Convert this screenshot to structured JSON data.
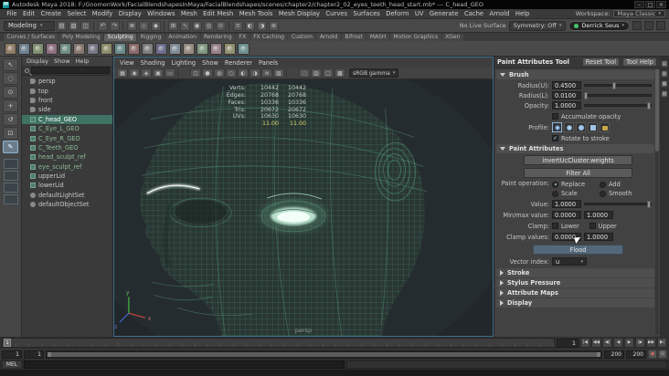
{
  "window": {
    "title": "Autodesk Maya 2018: F:/GnomonWork/FacialBlendshapesInMaya/FacialBlendshapes/scenes/chapter2/chapter2_02_eyes_teeth_head_start.mb* --- C_head_GEO",
    "buttons": [
      {
        "name": "minimize-button",
        "glyph": "–"
      },
      {
        "name": "maximize-button",
        "glyph": "□"
      },
      {
        "name": "close-button",
        "glyph": "×"
      }
    ],
    "logo_letter": "M"
  },
  "menubar": {
    "items": [
      {
        "label": "File"
      },
      {
        "label": "Edit"
      },
      {
        "label": "Create"
      },
      {
        "label": "Select"
      },
      {
        "label": "Modify"
      },
      {
        "label": "Display"
      },
      {
        "label": "Windows"
      },
      {
        "label": "Mesh"
      },
      {
        "label": "Edit Mesh"
      },
      {
        "label": "Mesh Tools"
      },
      {
        "label": "Mesh Display"
      },
      {
        "label": "Curves"
      },
      {
        "label": "Surfaces"
      },
      {
        "label": "Deform"
      },
      {
        "label": "UV"
      },
      {
        "label": "Generate"
      },
      {
        "label": "Cache"
      },
      {
        "label": "Arnold"
      },
      {
        "label": "Help"
      }
    ],
    "workspace_label": "Workspace:",
    "workspace_value": "Maya Classic"
  },
  "statusline": {
    "mode": "Modeling",
    "icons": [
      {
        "name": "new-scene-icon",
        "glyph": "▤"
      },
      {
        "name": "open-scene-icon",
        "glyph": "▧"
      },
      {
        "name": "save-scene-icon",
        "glyph": "◫"
      },
      {
        "cls": "sep"
      },
      {
        "name": "undo-icon",
        "glyph": "↶"
      },
      {
        "name": "redo-icon",
        "glyph": "↷"
      },
      {
        "cls": "sep"
      },
      {
        "name": "select-hierarchy-icon",
        "glyph": "≣"
      },
      {
        "name": "select-object-icon",
        "glyph": "◇"
      },
      {
        "name": "select-component-icon",
        "glyph": "◆"
      },
      {
        "cls": "sep"
      },
      {
        "name": "snap-grid-icon",
        "glyph": "⊞"
      },
      {
        "name": "snap-curve-icon",
        "glyph": "∿"
      },
      {
        "name": "snap-point-icon",
        "glyph": "◉"
      },
      {
        "name": "snap-view-plane-icon",
        "glyph": "◎"
      },
      {
        "name": "make-live-icon",
        "glyph": "⊙"
      },
      {
        "cls": "sep"
      },
      {
        "name": "construction-history-icon",
        "glyph": "≡"
      },
      {
        "name": "render-icon",
        "glyph": "◐"
      },
      {
        "name": "ipr-render-icon",
        "glyph": "◑"
      },
      {
        "name": "render-settings-icon",
        "glyph": "⊛"
      }
    ],
    "live_surface": "No Live Surface",
    "symmetry": "Symmetry: Off",
    "user": "Derrick Seus"
  },
  "shelf": {
    "tabs": [
      {
        "label": "Curves / Surfaces"
      },
      {
        "label": "Poly Modeling"
      },
      {
        "label": "Sculpting",
        "cls": "active"
      },
      {
        "label": "Rigging"
      },
      {
        "label": "Animation"
      },
      {
        "label": "Rendering"
      },
      {
        "label": "FX"
      },
      {
        "label": "FX Caching"
      },
      {
        "label": "Custom"
      },
      {
        "label": "Arnold"
      },
      {
        "label": "Bifrost"
      },
      {
        "label": "MASH"
      },
      {
        "label": "Motion Graphics"
      },
      {
        "label": "XGen"
      }
    ],
    "icons": [
      {
        "name": "shelf-sculpt-tool",
        "color": "#8d7a64"
      },
      {
        "name": "shelf-smooth-tool",
        "color": "#6e7f8d"
      },
      {
        "name": "shelf-relax-tool",
        "color": "#7d8d6e"
      },
      {
        "name": "shelf-grab-tool",
        "color": "#8d6e7d"
      },
      {
        "name": "shelf-pinch-tool",
        "color": "#6e8d84"
      },
      {
        "name": "shelf-flatten-tool",
        "color": "#84766e"
      },
      {
        "name": "shelf-foamy-tool",
        "color": "#767684"
      },
      {
        "name": "shelf-spray-tool",
        "color": "#8a8a6a"
      },
      {
        "name": "shelf-repeat-tool",
        "color": "#6a8a8a"
      },
      {
        "name": "shelf-imprint-tool",
        "color": "#8a6a6a"
      },
      {
        "name": "shelf-wax-tool",
        "color": "#7c7c7c"
      },
      {
        "name": "shelf-scrape-tool",
        "color": "#6a6a8a"
      },
      {
        "name": "shelf-fill-tool",
        "color": "#7f8a95"
      },
      {
        "name": "shelf-knife-tool",
        "color": "#958a7f"
      },
      {
        "name": "shelf-smear-tool",
        "color": "#7f957f"
      },
      {
        "name": "shelf-bulge-tool",
        "color": "#957f8a"
      },
      {
        "name": "shelf-amplify-tool",
        "color": "#8f8f6f"
      },
      {
        "name": "shelf-freeze-tool",
        "color": "#6f8f8f"
      }
    ]
  },
  "toolbox": {
    "tools": [
      {
        "name": "select-tool-icon",
        "glyph": "↖"
      },
      {
        "name": "lasso-tool-icon",
        "glyph": "◌"
      },
      {
        "name": "paint-select-tool-icon",
        "glyph": "⊙"
      },
      {
        "name": "move-tool-icon",
        "glyph": "+"
      },
      {
        "name": "rotate-tool-icon",
        "glyph": "↺"
      },
      {
        "name": "scale-tool-icon",
        "glyph": "⊡"
      },
      {
        "name": "last-tool-used-icon",
        "glyph": "✎",
        "cls": "current"
      }
    ],
    "layouts": [
      {
        "name": "layout-single-pane-button"
      },
      {
        "name": "layout-four-pane-button",
        "cls": "split"
      },
      {
        "name": "layout-persp-outliner-button",
        "cls": "split"
      },
      {
        "name": "layout-persp-graph-button",
        "cls": "split"
      }
    ]
  },
  "outliner": {
    "menus": [
      {
        "label": "Display"
      },
      {
        "label": "Show"
      },
      {
        "label": "Help"
      }
    ],
    "items": [
      {
        "label": "persp",
        "icon": "oi-camera"
      },
      {
        "label": "top",
        "icon": "oi-camera"
      },
      {
        "label": "front",
        "icon": "oi-camera"
      },
      {
        "label": "side",
        "icon": "oi-camera"
      },
      {
        "label": "C_head_GEO",
        "icon": "oi-mesh",
        "cls": "selected"
      },
      {
        "label": "C_Eye_L_GEO",
        "icon": "oi-mesh",
        "cls": "ref"
      },
      {
        "label": "C_Eye_R_GEO",
        "icon": "oi-mesh",
        "cls": "ref"
      },
      {
        "label": "C_Teeth_GEO",
        "icon": "oi-mesh",
        "cls": "ref"
      },
      {
        "label": "head_sculpt_ref",
        "icon": "oi-mesh",
        "cls": "ref"
      },
      {
        "label": "eye_sculpt_ref",
        "icon": "oi-mesh",
        "cls": "ref"
      },
      {
        "label": "upperLid",
        "icon": "oi-mesh"
      },
      {
        "label": "lowerLid",
        "icon": "oi-mesh"
      },
      {
        "label": "defaultLightSet",
        "icon": "oi-set"
      },
      {
        "label": "defaultObjectSet",
        "icon": "oi-set"
      }
    ]
  },
  "viewport": {
    "menus": [
      {
        "label": "View"
      },
      {
        "label": "Shading"
      },
      {
        "label": "Lighting"
      },
      {
        "label": "Show"
      },
      {
        "label": "Renderer"
      },
      {
        "label": "Panels"
      }
    ],
    "toolbar_icons": [
      {
        "name": "select-camera-icon",
        "glyph": "▦"
      },
      {
        "name": "lock-camera-icon",
        "glyph": "◉"
      },
      {
        "name": "camera-attributes-icon",
        "glyph": "◈"
      },
      {
        "name": "bookmarks-icon",
        "glyph": "▣"
      },
      {
        "name": "image-plane-icon",
        "glyph": "▭"
      },
      {
        "cls": "sep"
      },
      {
        "name": "wireframe-icon",
        "glyph": "◻"
      },
      {
        "name": "shaded-icon",
        "glyph": "●"
      },
      {
        "name": "textured-icon",
        "glyph": "◍"
      },
      {
        "name": "lights-icon",
        "glyph": "○"
      },
      {
        "name": "shadows-icon",
        "glyph": "◐"
      },
      {
        "name": "ambient-occlusion-icon",
        "glyph": "◑"
      },
      {
        "name": "motion-blur-icon",
        "glyph": "≋"
      },
      {
        "name": "anti-aliasing-icon",
        "glyph": "▨"
      },
      {
        "cls": "sep"
      },
      {
        "name": "isolate-select-icon",
        "glyph": "◌"
      },
      {
        "name": "field-chart-icon",
        "glyph": "▥"
      },
      {
        "name": "resolution-gate-icon",
        "glyph": "▢"
      },
      {
        "name": "gate-mask-icon",
        "glyph": "▩"
      }
    ],
    "gamma": "sRGB gamma",
    "hud_rows": [
      {
        "label": "Verts:",
        "a": "10442",
        "b": "10442"
      },
      {
        "label": "Edges:",
        "a": "20768",
        "b": "20768"
      },
      {
        "label": "Faces:",
        "a": "10336",
        "b": "10336"
      },
      {
        "label": "Tris:",
        "a": "20672",
        "b": "20672"
      },
      {
        "label": "UVs:",
        "a": "10630",
        "b": "10630"
      },
      {
        "label": "",
        "a": "11.00",
        "b": "11.00",
        "cls": "yellow"
      }
    ],
    "camera_label": "persp",
    "axis": {
      "x": "x",
      "y": "y",
      "z": "z"
    }
  },
  "tool_panel": {
    "title": "Paint Attributes Tool",
    "reset_label": "Reset Tool",
    "help_label": "Tool Help",
    "brush": {
      "header": "Brush",
      "sliders": [
        {
          "label": "Radius(U):",
          "value": "0.4500",
          "pos": 44
        },
        {
          "label": "Radius(L):",
          "value": "0.0100",
          "pos": 2
        },
        {
          "label": "Opacity:",
          "value": "1.0000",
          "pos": 97
        }
      ],
      "accumulate_label": "Accumulate opacity",
      "profile_label": "Profile:",
      "profile_icons": [
        {
          "name": "brush-profile-gaussian-icon",
          "cls": "p-gauss"
        },
        {
          "name": "brush-profile-soft-icon",
          "cls": "p-soft"
        },
        {
          "name": "brush-profile-solid-icon",
          "cls": "p-solid"
        },
        {
          "name": "brush-profile-square-icon",
          "cls": "p-square"
        },
        {
          "name": "browse-brush-profile-icon",
          "cls": "p-folder"
        }
      ],
      "rotate_label": "Rotate to stroke",
      "rotate_check": "✓"
    },
    "paint": {
      "header": "Paint Attributes",
      "attribute_button": "invertUcCluster.weights",
      "filter_button": "Filter All",
      "operation_label": "Paint operation:",
      "operations": [
        {
          "label": "Replace",
          "cls": "on"
        },
        {
          "label": "Add"
        },
        {
          "label": "Scale"
        },
        {
          "label": "Smooth"
        }
      ],
      "value_row": {
        "label": "Value:",
        "value": "1.0000",
        "pos": 97
      },
      "minmax_label": "Min/max value:",
      "min_value": "0.0000",
      "max_value": "1.0000",
      "clamp_label": "Clamp:",
      "clamp_lower": "Lower",
      "clamp_upper": "Upper",
      "clamp_values_label": "Clamp values:",
      "clamp_min": "0.0000",
      "clamp_max": "1.0000",
      "flood_button": "Flood",
      "vector_label": "Vector index:",
      "vector_value": "u"
    },
    "collapsed_sections": [
      {
        "label": "Stroke"
      },
      {
        "label": "Stylus Pressure"
      },
      {
        "label": "Attribute Maps"
      },
      {
        "label": "Display"
      }
    ]
  },
  "rightstrip": {
    "icons": [
      {
        "name": "channel-box-icon",
        "glyph": "▤"
      },
      {
        "name": "attribute-editor-icon",
        "glyph": "▥"
      },
      {
        "name": "tool-settings-icon",
        "glyph": "▦"
      },
      {
        "name": "modeling-toolkit-icon",
        "glyph": "▧"
      }
    ]
  },
  "timeline": {
    "current_frame": "1",
    "playback": [
      {
        "name": "go-to-start-button",
        "glyph": "|◀"
      },
      {
        "name": "step-back-frame-button",
        "glyph": "◀◀"
      },
      {
        "name": "step-back-key-button",
        "glyph": "◀|"
      },
      {
        "name": "play-backwards-button",
        "glyph": "◀"
      },
      {
        "name": "play-forwards-button",
        "glyph": "▶"
      },
      {
        "name": "step-forward-key-button",
        "glyph": "|▶"
      },
      {
        "name": "step-forward-frame-button",
        "glyph": "▶▶"
      },
      {
        "name": "go-to-end-button",
        "glyph": "▶|"
      }
    ]
  },
  "range": {
    "start": "1",
    "inner_start": "1",
    "inner_end": "200",
    "end": "200",
    "extras": [
      {
        "name": "auto-key-button",
        "glyph": "◆",
        "cls": "autokey"
      },
      {
        "name": "animation-preferences-button",
        "glyph": "⊙"
      }
    ]
  },
  "command_line": {
    "mel_label": "MEL"
  },
  "colors": {
    "wireframe": "#3f8066",
    "eye_glow": "#eafff3",
    "selection_highlight": "#3f7364",
    "accent_blue": "#91c5ea"
  }
}
